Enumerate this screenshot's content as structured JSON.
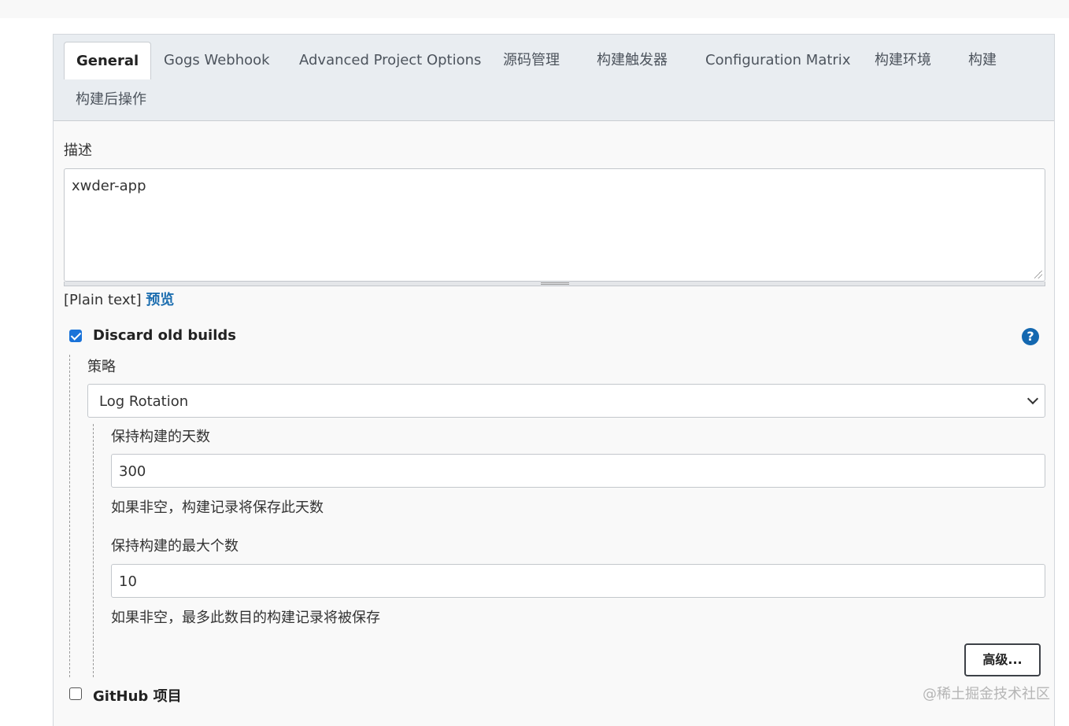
{
  "tabs": [
    {
      "label": "General",
      "active": true
    },
    {
      "label": "Gogs Webhook"
    },
    {
      "label": "Advanced Project Options"
    },
    {
      "label": "源码管理"
    },
    {
      "label": "构建触发器"
    },
    {
      "label": "Configuration Matrix"
    },
    {
      "label": "构建环境"
    },
    {
      "label": "构建"
    },
    {
      "label": "构建后操作"
    }
  ],
  "description": {
    "label": "描述",
    "value": "xwder-app",
    "format_text": "[Plain text]",
    "preview_link": "预览"
  },
  "discard_old_builds": {
    "checked": true,
    "label": "Discard old builds",
    "help_icon": "help-question-icon",
    "strategy_label": "策略",
    "strategy_value": "Log Rotation",
    "days_label": "保持构建的天数",
    "days_value": "300",
    "days_help": "如果非空，构建记录将保存此天数",
    "max_label": "保持构建的最大个数",
    "max_value": "10",
    "max_help": "如果非空，最多此数目的构建记录将被保存",
    "advanced_button": "高级..."
  },
  "github_project": {
    "checked": false,
    "label": "GitHub 项目"
  },
  "watermark": "@稀土掘金技术社区",
  "colors": {
    "accent": "#1a73d9",
    "link": "#1e6fb0",
    "help_icon": "#1468b0",
    "tab_bar": "#e9edf1"
  }
}
